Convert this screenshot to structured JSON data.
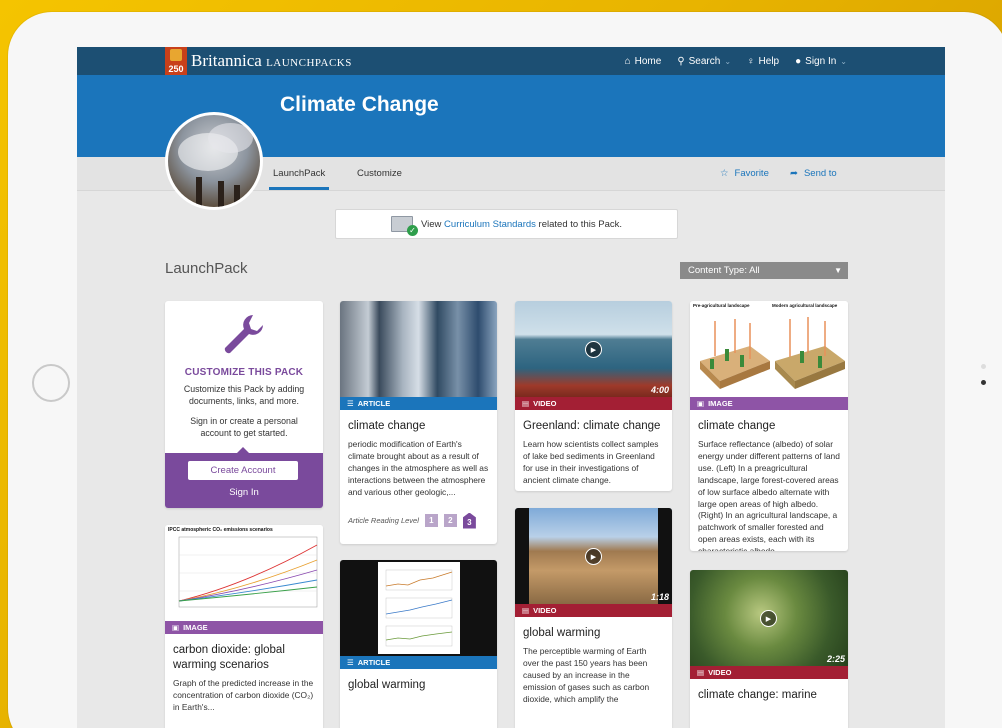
{
  "brand": {
    "badge": "250",
    "name": "Britannica",
    "product": "LaunchPacks"
  },
  "topnav": {
    "home": "Home",
    "search": "Search",
    "help": "Help",
    "signin": "Sign In"
  },
  "banner": {
    "title": "Climate Change"
  },
  "tabs": {
    "launchpack": "LaunchPack",
    "customize": "Customize",
    "favorite": "Favorite",
    "send_to": "Send to"
  },
  "curriculum": {
    "prefix": "View ",
    "link": "Curriculum Standards",
    "suffix": " related to this Pack."
  },
  "section": {
    "title": "LaunchPack",
    "content_type": "Content Type: All"
  },
  "customize_card": {
    "title": "CUSTOMIZE THIS PACK",
    "desc": "Customize this Pack by adding documents, links, and more.",
    "desc2": "Sign in or create a personal account to get started.",
    "create": "Create Account",
    "signin": "Sign In"
  },
  "cards": {
    "c1": {
      "tag": "ARTICLE",
      "title": "climate change",
      "text": "periodic modification of Earth's climate brought about as a result of changes in the atmosphere as well as interactions between the atmosphere and various other geologic,...",
      "reading_label": "Article Reading Level",
      "levels": [
        "1",
        "2",
        "3"
      ]
    },
    "c2": {
      "tag": "VIDEO",
      "duration": "4:00",
      "title": "Greenland: climate change",
      "text": "Learn how scientists collect samples of lake bed sediments in Greenland for use in their investigations of ancient climate change."
    },
    "c3": {
      "tag": "IMAGE",
      "title": "climate change",
      "text": "Surface reflectance (albedo) of solar energy under different patterns of land use. (Left) In a preagricultural landscape, large forest-covered areas of low surface albedo alternate with large open areas of high albedo. (Right) In an agricultural landscape, a patchwork of smaller forested and open areas exists, each with its characteristic albedo.",
      "img_left": "Pre-agricultural landscape",
      "img_right": "Modern agricultural landscape"
    },
    "c4": {
      "tag": "IMAGE",
      "title": "carbon dioxide: global warming scenarios",
      "text": "Graph of the predicted increase in the concentration of carbon dioxide (CO₂) in Earth's...",
      "img_title": "IPCC atmospheric CO₂ emissions scenarios"
    },
    "c5": {
      "tag": "ARTICLE",
      "title": "global warming"
    },
    "c6": {
      "tag": "VIDEO",
      "duration": "1:18",
      "title": "global warming",
      "text": "The perceptible warming of Earth over the past 150 years has been caused by an increase in the emission of gases such as carbon dioxide, which amplify the"
    },
    "c7": {
      "tag": "VIDEO",
      "duration": "2:25",
      "title": "climate change: marine"
    }
  }
}
